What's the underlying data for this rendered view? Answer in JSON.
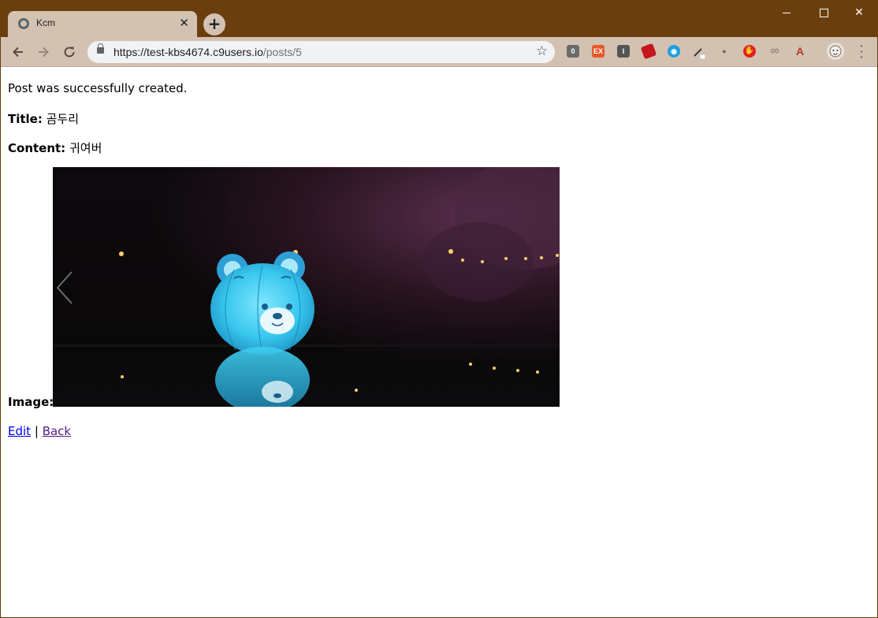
{
  "browser": {
    "tab_title": "Kcm",
    "tab_close": "✕",
    "new_tab": "+",
    "url_host": "https://test-kbs4674.c9users.io",
    "url_path": "/posts/5",
    "window_controls": {
      "minimize": "",
      "maximize": "",
      "close": "✕"
    },
    "extensions": [
      {
        "name": "0-icon",
        "label": "0",
        "color": "#6b6b6b"
      },
      {
        "name": "ex-icon",
        "label": "EX",
        "color": "#e8572a"
      },
      {
        "name": "i-icon",
        "label": "I",
        "color": "#555555"
      },
      {
        "name": "ruby-icon",
        "label": "",
        "color": "#c4161c"
      },
      {
        "name": "eye-icon",
        "label": "◉",
        "color": "#1e9fe0"
      },
      {
        "name": "eyedropper-icon",
        "label": "",
        "color": "#5a5a5a"
      },
      {
        "name": "card-icon",
        "label": "▪",
        "color": "#d3c2b2"
      },
      {
        "name": "adblock-icon",
        "label": "✋",
        "color": "#e02020"
      },
      {
        "name": "link-icon",
        "label": "∞",
        "color": "#9a8a7c"
      },
      {
        "name": "pdf-icon",
        "label": "A",
        "color": "#b5392b"
      },
      {
        "name": "profile-avatar",
        "label": "",
        "color": "#e8e2da"
      }
    ]
  },
  "page": {
    "notice": "Post was successfully created.",
    "title_label": "Title:",
    "title_value": "곰두리",
    "content_label": "Content:",
    "content_value": "귀여버",
    "image_label": "Image:",
    "image_alt": "Inflatable blue bear lantern at night over water",
    "edit_link": "Edit",
    "separator": "|",
    "back_link": "Back"
  }
}
